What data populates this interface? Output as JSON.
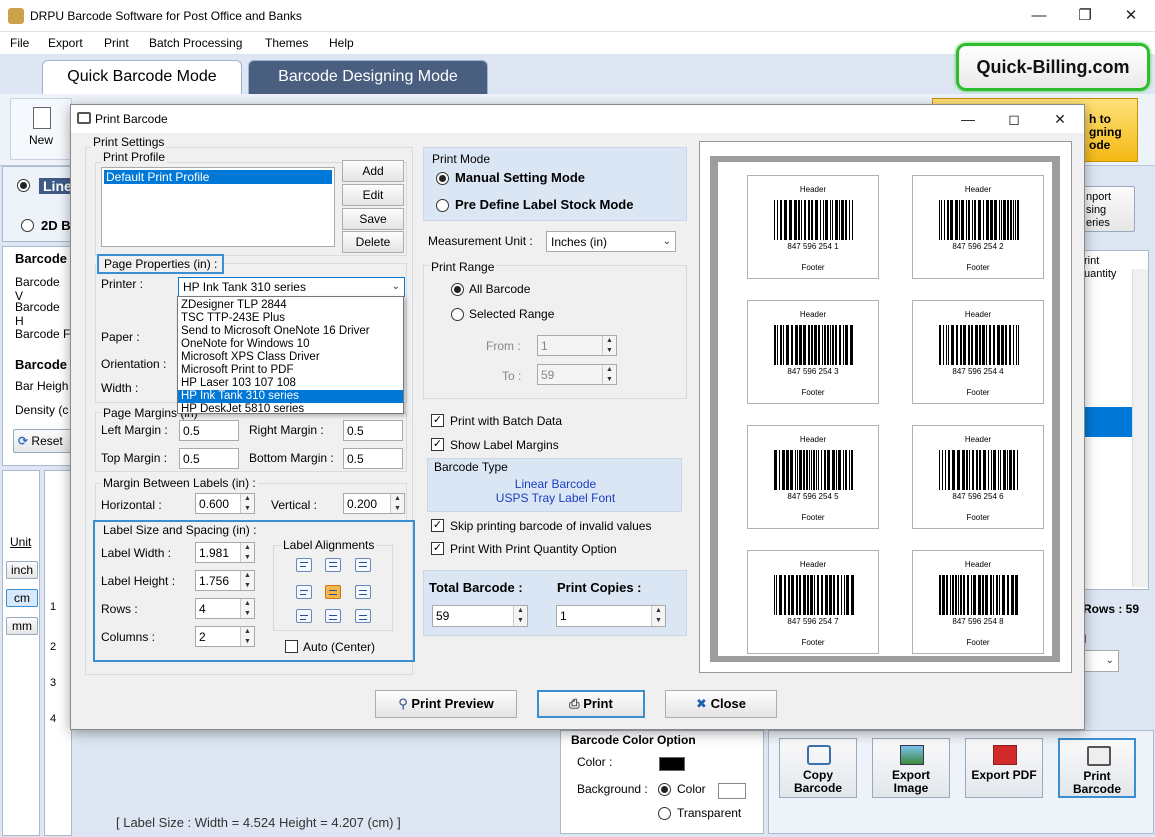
{
  "app": {
    "title": "DRPU Barcode Software for Post Office and Banks",
    "menu": [
      "File",
      "Export",
      "Print",
      "Batch Processing",
      "Themes",
      "Help"
    ],
    "tabs": [
      "Quick Barcode Mode",
      "Barcode Designing Mode"
    ],
    "logo_text": "Quick-Billing.com",
    "ribbon": {
      "new_label": "New",
      "switch_label": "h to gning ode"
    },
    "left_panel": {
      "linear_label": "Line",
      "twod_label": "2D B",
      "barcode_header": "Barcode",
      "rows": [
        "Barcode V",
        "Barcode H",
        "Barcode F"
      ],
      "barcode_header2": "Barcode",
      "rows2": [
        "Bar Heigh",
        "Density (c"
      ],
      "reset_label": "Reset"
    },
    "units": {
      "title": "Unit",
      "inch": "inch",
      "cm": "cm",
      "mm": "mm"
    },
    "ruler": [
      "1",
      "2",
      "3",
      "4"
    ],
    "right_panel": {
      "import_label": "nport sing eries",
      "print_qty": "rint uantity",
      "rows_label": "Rows : 59",
      "i_label": "I"
    },
    "status_bar": "[ Label Size : Width = 4.524  Height = 4.207 (cm) ]",
    "color_option": {
      "title": "Barcode Color Option",
      "color_label": "Color :",
      "background_label": "Background :",
      "bg_color": "Color",
      "transparent": "Transparent"
    },
    "tools": [
      "Copy Barcode",
      "Export Image",
      "Export PDF",
      "Print Barcode"
    ]
  },
  "dialog": {
    "title": "Print Barcode",
    "print_settings": "Print Settings",
    "print_profile": {
      "title": "Print Profile",
      "items": [
        "Default Print Profile"
      ],
      "buttons": [
        "Add",
        "Edit",
        "Save",
        "Delete"
      ]
    },
    "page_properties": {
      "title": "Page Properties (in) :",
      "printer_label": "Printer :",
      "printer_value": "HP Ink Tank 310 series",
      "paper_label": "Paper :",
      "orientation_label": "Orientation :",
      "width_label": "Width :",
      "printer_options": [
        "ZDesigner TLP 2844",
        "TSC TTP-243E Plus",
        "Send to Microsoft OneNote 16 Driver",
        "OneNote for Windows 10",
        "Microsoft XPS Class Driver",
        "Microsoft Print to PDF",
        "HP Laser 103 107 108",
        "HP Ink Tank 310 series",
        "HP DeskJet 5810 series"
      ]
    },
    "page_margins": {
      "title": "Page Margins (in)",
      "left_label": "Left Margin :",
      "left": "0.5",
      "right_label": "Right Margin :",
      "right": "0.5",
      "top_label": "Top Margin :",
      "top": "0.5",
      "bottom_label": "Bottom Margin :",
      "bottom": "0.5"
    },
    "margin_between": {
      "title": "Margin Between Labels (in) :",
      "horizontal_label": "Horizontal :",
      "horizontal": "0.600",
      "vertical_label": "Vertical :",
      "vertical": "0.200"
    },
    "label_size": {
      "title": "Label Size and Spacing (in) :",
      "width_label": "Label Width :",
      "width": "1.981",
      "height_label": "Label Height :",
      "height": "1.756",
      "rows_label": "Rows :",
      "rows": "4",
      "columns_label": "Columns :",
      "columns": "2",
      "alignments_title": "Label Alignments",
      "auto_center": "Auto (Center)"
    },
    "print_mode": {
      "title": "Print Mode",
      "manual": "Manual Setting Mode",
      "predefine": "Pre Define Label Stock Mode"
    },
    "measurement": {
      "label": "Measurement Unit :",
      "value": "Inches (in)"
    },
    "print_range": {
      "title": "Print Range",
      "all": "All Barcode",
      "selected": "Selected Range",
      "from_label": "From :",
      "from": "1",
      "to_label": "To :",
      "to": "59"
    },
    "options": {
      "batch": "Print with Batch Data",
      "margins": "Show Label Margins"
    },
    "barcode_type": {
      "title": "Barcode Type",
      "line1": "Linear Barcode",
      "line2": "USPS Tray Label Font"
    },
    "options2": {
      "skip": "Skip printing barcode of invalid values",
      "quantity": "Print With Print Quantity Option"
    },
    "totals": {
      "total_label": "Total Barcode :",
      "total": "59",
      "copies_label": "Print Copies :",
      "copies": "1"
    },
    "preview_labels": [
      {
        "header": "Header",
        "number": "847 596 254 1",
        "footer": "Footer"
      },
      {
        "header": "Header",
        "number": "847 596 254 2",
        "footer": "Footer"
      },
      {
        "header": "Header",
        "number": "847 596 254 3",
        "footer": "Footer"
      },
      {
        "header": "Header",
        "number": "847 596 254 4",
        "footer": "Footer"
      },
      {
        "header": "Header",
        "number": "847 596 254 5",
        "footer": "Footer"
      },
      {
        "header": "Header",
        "number": "847 596 254 6",
        "footer": "Footer"
      },
      {
        "header": "Header",
        "number": "847 596 254 7",
        "footer": "Footer"
      },
      {
        "header": "Header",
        "number": "847 596 254 8",
        "footer": "Footer"
      }
    ],
    "buttons": {
      "preview": "Print Preview",
      "print": "Print",
      "close": "Close"
    }
  }
}
